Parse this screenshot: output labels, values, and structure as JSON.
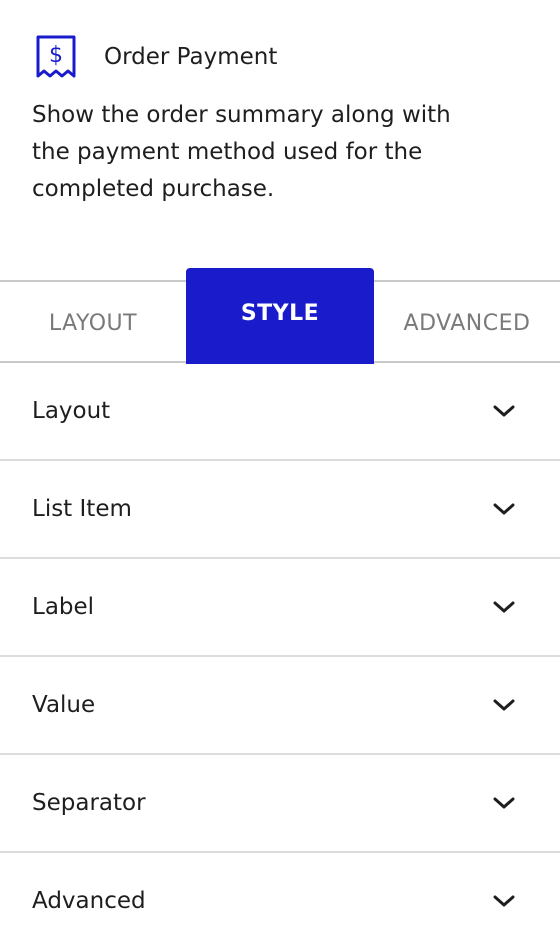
{
  "block": {
    "icon": "receipt-dollar-icon",
    "title": "Order Payment",
    "description": "Show the order summary along with the payment method used for the completed purchase."
  },
  "tabs": [
    {
      "label": "LAYOUT",
      "active": false
    },
    {
      "label": "STYLE",
      "active": true
    },
    {
      "label": "ADVANCED",
      "active": false
    }
  ],
  "panels": [
    {
      "label": "Layout",
      "icon": "chevron-down-icon"
    },
    {
      "label": "List Item",
      "icon": "chevron-down-icon"
    },
    {
      "label": "Label",
      "icon": "chevron-down-icon"
    },
    {
      "label": "Value",
      "icon": "chevron-down-icon"
    },
    {
      "label": "Separator",
      "icon": "chevron-down-icon"
    },
    {
      "label": "Advanced",
      "icon": "chevron-down-icon"
    }
  ],
  "colors": {
    "accent": "#1a1ccc",
    "text": "#1e1e1e",
    "muted": "#7a7a7a",
    "divider": "#dddddd"
  }
}
